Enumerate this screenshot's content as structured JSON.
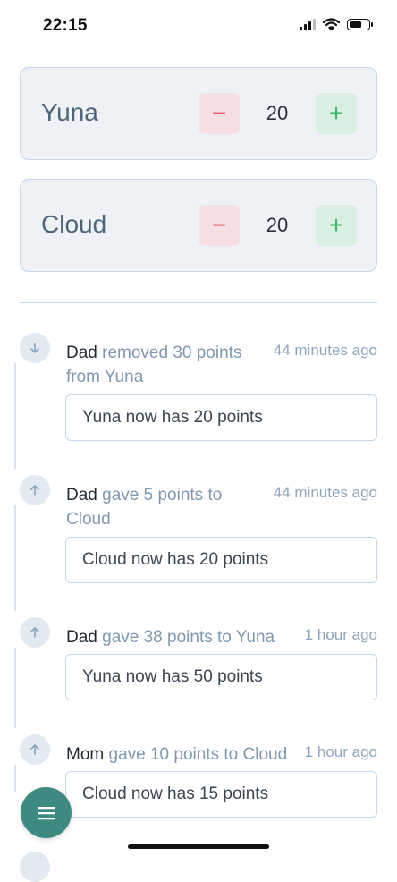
{
  "status_bar": {
    "time": "22:15"
  },
  "players": [
    {
      "name": "Yuna",
      "score": "20",
      "minus_label": "−",
      "plus_label": "+"
    },
    {
      "name": "Cloud",
      "score": "20",
      "minus_label": "−",
      "plus_label": "+"
    }
  ],
  "activity": [
    {
      "actor": "Dad",
      "action": "removed 30 points from Yuna",
      "time": "44 minutes ago",
      "direction": "down",
      "detail": "Yuna now has 20 points"
    },
    {
      "actor": "Dad",
      "action": "gave 5 points to Cloud",
      "time": "44 minutes ago",
      "direction": "up",
      "detail": "Cloud now has 20 points"
    },
    {
      "actor": "Dad",
      "action": "gave 38 points to Yuna",
      "time": "1 hour ago",
      "direction": "up",
      "detail": "Yuna now has 50 points"
    },
    {
      "actor": "Mom",
      "action": "gave 10 points to Cloud",
      "time": "1 hour ago",
      "direction": "up",
      "detail": "Cloud now has 15 points"
    }
  ],
  "icons": {
    "activity_down": "arrow-down-icon",
    "activity_up": "arrow-up-icon",
    "fab": "menu-icon"
  },
  "colors": {
    "minus": "#e35d6a",
    "plus": "#34b36a",
    "fab": "#3e8a80",
    "card_bg": "#eef2f7"
  }
}
